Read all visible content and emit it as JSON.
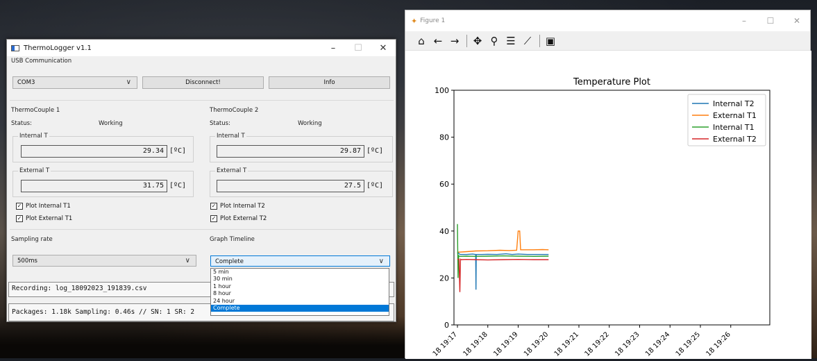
{
  "thermologger": {
    "title": "ThermoLogger v1.1",
    "usb_section": "USB Communication",
    "port": "COM3",
    "disconnect_label": "Disconnect!",
    "info_label": "Info",
    "tc1": {
      "title": "ThermoCouple 1",
      "status_label": "Status:",
      "status_value": "Working",
      "internal_label": "Internal T",
      "internal_value": "29.34",
      "external_label": "External T",
      "external_value": "31.75",
      "unit": "[ºC]",
      "plot_internal": "Plot Internal T1",
      "plot_external": "Plot External T1"
    },
    "tc2": {
      "title": "ThermoCouple 2",
      "status_label": "Status:",
      "status_value": "Working",
      "internal_label": "Internal T",
      "internal_value": "29.87",
      "external_label": "External T",
      "external_value": "27.5",
      "unit": "[ºC]",
      "plot_internal": "Plot Internal T2",
      "plot_external": "Plot External T2"
    },
    "sampling_label": "Sampling rate",
    "sampling_value": "500ms",
    "timeline_label": "Graph Timeline",
    "timeline_value": "Complete",
    "timeline_options": [
      "5 min",
      "30 min",
      "1 hour",
      "8 hour",
      "24 hour",
      "Complete"
    ],
    "recording": "Recording: log_18092023_191839.csv",
    "packages": "Packages: 1.18k Sampling: 0.46s // SN: 1 SR: 2"
  },
  "figure": {
    "title": "Figure 1",
    "toolbar_icons": [
      "home-icon",
      "back-arrow-icon",
      "forward-arrow-icon",
      "pan-icon",
      "zoom-icon",
      "subplots-icon",
      "edit-axis-icon",
      "save-icon"
    ]
  },
  "chart_data": {
    "type": "line",
    "title": "Temperature Plot",
    "xlabel": "",
    "ylabel": "",
    "ylim": [
      0,
      100
    ],
    "yticks": [
      0,
      20,
      40,
      60,
      80,
      100
    ],
    "xticks": [
      "18 19:17",
      "18 19:18",
      "18 19:19",
      "18 19:20",
      "18 19:21",
      "18 19:22",
      "18 19:23",
      "18 19:24",
      "18 19:25",
      "18 19:26"
    ],
    "legend_position": "top-right",
    "series": [
      {
        "name": "Internal T2",
        "color": "#1f77b4",
        "x": [
          0,
          0.02,
          0.05,
          0.1,
          0.3,
          0.5,
          0.6,
          0.61,
          0.62,
          0.8,
          1.0,
          1.3,
          1.6,
          1.8,
          2.0,
          2.3,
          2.6,
          3.0
        ],
        "y": [
          30.5,
          31,
          30.3,
          30,
          30,
          30.2,
          30,
          15,
          30,
          30,
          30.1,
          30,
          30.3,
          30,
          30.2,
          30,
          30,
          30
        ]
      },
      {
        "name": "External T1",
        "color": "#ff7f0e",
        "x": [
          0,
          0.05,
          0.3,
          0.6,
          1.0,
          1.4,
          1.7,
          1.95,
          2.0,
          2.05,
          2.08,
          2.1,
          2.2,
          2.5,
          2.8,
          3.0
        ],
        "y": [
          31,
          31,
          31.2,
          31.5,
          31.6,
          31.8,
          31.7,
          31.8,
          40,
          40,
          32,
          32,
          32,
          32,
          32.1,
          32
        ]
      },
      {
        "name": "Internal T1",
        "color": "#2ca02c",
        "x": [
          0,
          0.02,
          0.04,
          0.06,
          0.1,
          0.3,
          0.6,
          1.0,
          1.5,
          2.0,
          2.5,
          3.0
        ],
        "y": [
          43,
          20,
          29.5,
          29.3,
          29.2,
          29.3,
          29.2,
          29.3,
          29.4,
          29.3,
          29.2,
          29.3
        ]
      },
      {
        "name": "External T2",
        "color": "#d62728",
        "x": [
          0,
          0.05,
          0.08,
          0.1,
          0.12,
          0.3,
          0.6,
          1.0,
          1.5,
          2.0,
          2.5,
          3.0
        ],
        "y": [
          28,
          28,
          14,
          28,
          27.8,
          27.9,
          27.8,
          27.7,
          27.8,
          27.9,
          27.8,
          27.8
        ]
      }
    ]
  }
}
